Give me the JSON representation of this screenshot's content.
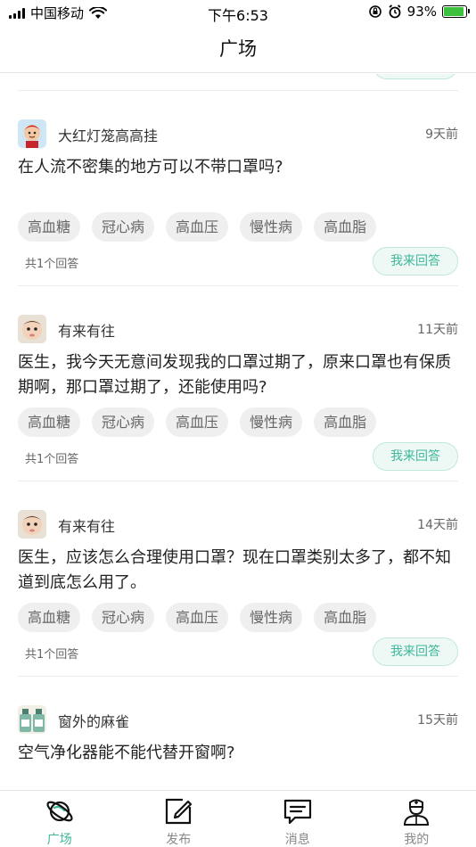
{
  "status_bar": {
    "carrier": "中国移动",
    "time": "下午6:53",
    "battery_percent": "93%",
    "battery_level": 0.93
  },
  "header": {
    "title": "广场"
  },
  "posts": [
    {
      "user": "大红灯笼高高挂",
      "ago": "9天前",
      "question": "在人流不密集的地方可以不带口罩吗?",
      "tags": [
        "高血糖",
        "冠心病",
        "高血压",
        "慢性病",
        "高血脂"
      ],
      "answer_count": "共1个回答",
      "answer_button": "我来回答"
    },
    {
      "user": "有来有往",
      "ago": "11天前",
      "question": "医生，我今天无意间发现我的口罩过期了，原来口罩也有保质期啊，那口罩过期了，还能使用吗?",
      "tags": [
        "高血糖",
        "冠心病",
        "高血压",
        "慢性病",
        "高血脂"
      ],
      "answer_count": "共1个回答",
      "answer_button": "我来回答"
    },
    {
      "user": "有来有往",
      "ago": "14天前",
      "question": "医生，应该怎么合理使用口罩？现在口罩类别太多了，都不知道到底怎么用了。",
      "tags": [
        "高血糖",
        "冠心病",
        "高血压",
        "慢性病",
        "高血脂"
      ],
      "answer_count": "共1个回答",
      "answer_button": "我来回答"
    },
    {
      "user": "窗外的麻雀",
      "ago": "15天前",
      "question": "空气净化器能不能代替开窗啊?"
    }
  ],
  "tabbar": {
    "items": [
      {
        "label": "广场",
        "icon": "planet-icon",
        "active": true
      },
      {
        "label": "发布",
        "icon": "edit-icon",
        "active": false
      },
      {
        "label": "消息",
        "icon": "message-icon",
        "active": false
      },
      {
        "label": "我的",
        "icon": "doctor-icon",
        "active": false
      }
    ]
  },
  "colors": {
    "accent": "#3fb79a",
    "tag_bg": "#efefef",
    "button_bg": "#eef9f6"
  }
}
